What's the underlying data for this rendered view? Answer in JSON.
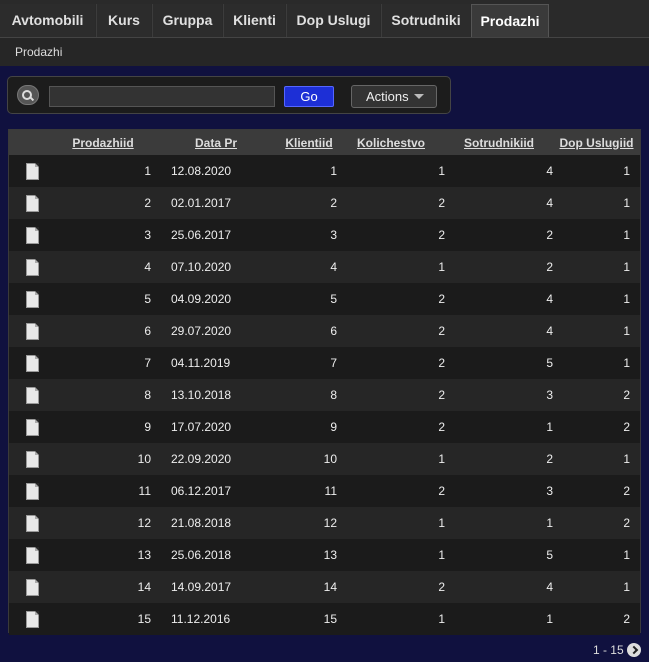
{
  "tabs": [
    "Avtomobili",
    "Kurs",
    "Gruppa",
    "Klienti",
    "Dop Uslugi",
    "Sotrudniki",
    "Prodazhi"
  ],
  "active_tab": "Prodazhi",
  "breadcrumb": "Prodazhi",
  "toolbar": {
    "search_value": "",
    "go_label": "Go",
    "actions_label": "Actions"
  },
  "table": {
    "columns": [
      "Prodazhiid",
      "Data Pr",
      "Klientiid",
      "Kolichestvo",
      "Sotrudnikiid",
      "Dop Uslugiid"
    ],
    "rows": [
      [
        "1",
        "12.08.2020",
        "1",
        "1",
        "4",
        "1"
      ],
      [
        "2",
        "02.01.2017",
        "2",
        "2",
        "4",
        "1"
      ],
      [
        "3",
        "25.06.2017",
        "3",
        "2",
        "2",
        "1"
      ],
      [
        "4",
        "07.10.2020",
        "4",
        "1",
        "2",
        "1"
      ],
      [
        "5",
        "04.09.2020",
        "5",
        "2",
        "4",
        "1"
      ],
      [
        "6",
        "29.07.2020",
        "6",
        "2",
        "4",
        "1"
      ],
      [
        "7",
        "04.11.2019",
        "7",
        "2",
        "5",
        "1"
      ],
      [
        "8",
        "13.10.2018",
        "8",
        "2",
        "3",
        "2"
      ],
      [
        "9",
        "17.07.2020",
        "9",
        "2",
        "1",
        "2"
      ],
      [
        "10",
        "22.09.2020",
        "10",
        "1",
        "2",
        "1"
      ],
      [
        "11",
        "06.12.2017",
        "11",
        "2",
        "3",
        "2"
      ],
      [
        "12",
        "21.08.2018",
        "12",
        "1",
        "1",
        "2"
      ],
      [
        "13",
        "25.06.2018",
        "13",
        "1",
        "5",
        "1"
      ],
      [
        "14",
        "14.09.2017",
        "14",
        "2",
        "4",
        "1"
      ],
      [
        "15",
        "11.12.2016",
        "15",
        "1",
        "1",
        "2"
      ]
    ]
  },
  "pagination": {
    "range": "1 - 15"
  }
}
